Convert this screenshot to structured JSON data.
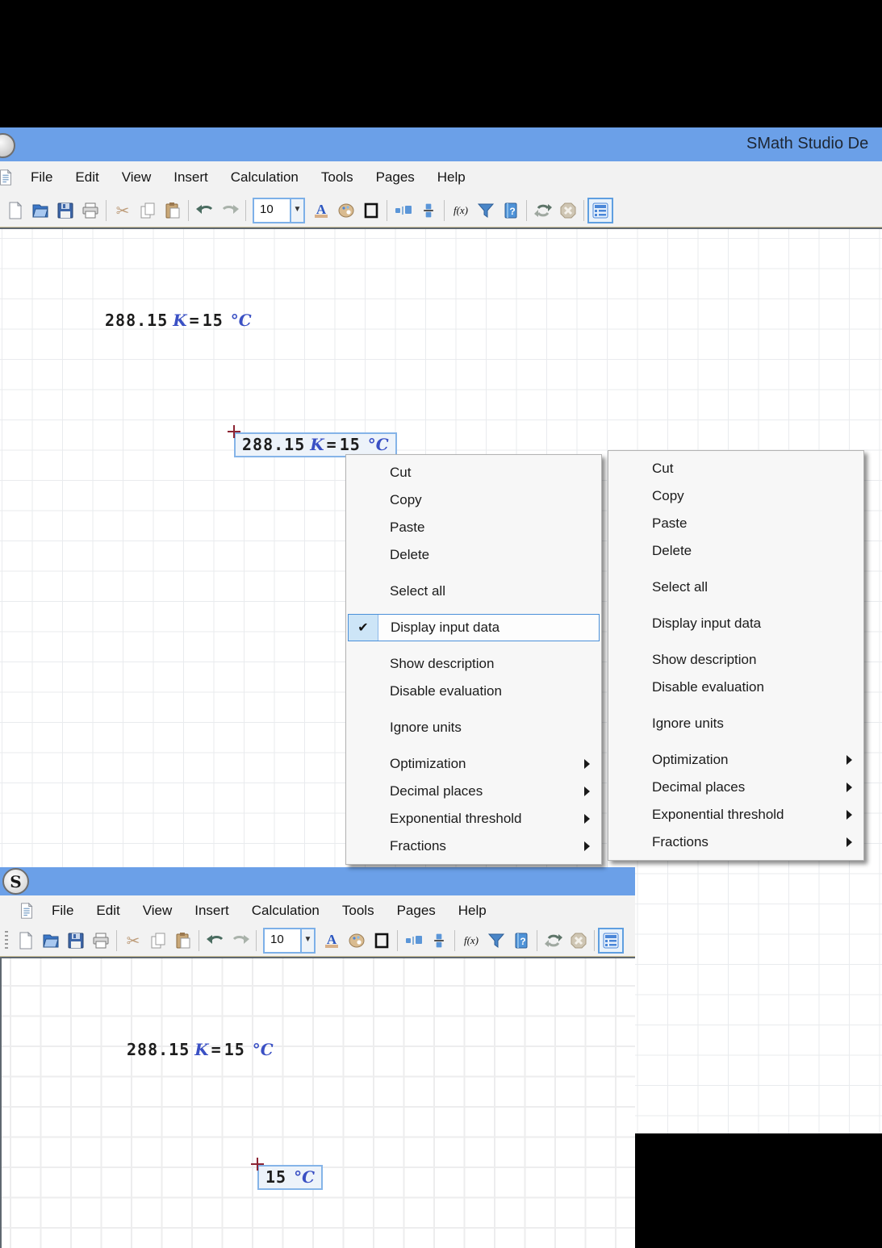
{
  "window_back": {
    "title": "SMath Studio De",
    "menu": [
      "File",
      "Edit",
      "View",
      "Insert",
      "Calculation",
      "Tools",
      "Pages",
      "Help"
    ],
    "toolbar": {
      "font_size": "10",
      "items": [
        "new",
        "open",
        "save",
        "print",
        "|",
        "cut",
        "copy",
        "paste",
        "|",
        "undo",
        "redo",
        "|",
        "fontsize",
        "fontcolor",
        "palette",
        "border",
        "|",
        "units",
        "fraction",
        "|",
        "fx",
        "filter",
        "helpbook",
        "|",
        "refresh",
        "stop",
        "|",
        "options"
      ]
    },
    "expression": {
      "lhs": "288.15",
      "lhs_unit": "K",
      "eq": "=",
      "rhs": "15",
      "rhs_unit": "°C"
    },
    "selected_expression": {
      "lhs": "288.15",
      "lhs_unit": "K",
      "eq": "=",
      "rhs": "15",
      "rhs_unit": "°C"
    }
  },
  "window_front": {
    "logo": "S",
    "menu": [
      "File",
      "Edit",
      "View",
      "Insert",
      "Calculation",
      "Tools",
      "Pages",
      "Help"
    ],
    "toolbar": {
      "grip": true,
      "font_size": "10",
      "items": [
        "new",
        "open",
        "save",
        "print",
        "|",
        "cut",
        "copy",
        "paste",
        "|",
        "undo",
        "redo",
        "|",
        "fontsize",
        "fontcolor",
        "palette",
        "border",
        "|",
        "units",
        "fraction",
        "|",
        "fx",
        "filter",
        "helpbook",
        "|",
        "refresh",
        "stop",
        "|",
        "options"
      ]
    },
    "expression": {
      "lhs": "288.15",
      "lhs_unit": "K",
      "eq": "=",
      "rhs": "15",
      "rhs_unit": "°C"
    },
    "selected_expression": {
      "rhs": "15",
      "rhs_unit": "°C"
    }
  },
  "menus": {
    "left": {
      "items": [
        {
          "label": "Cut"
        },
        {
          "label": "Copy"
        },
        {
          "label": "Paste"
        },
        {
          "label": "Delete"
        },
        {
          "label": "Select all",
          "gap": true
        },
        {
          "label": "Display input data",
          "gap": true,
          "checked": true,
          "highlighted": true
        },
        {
          "label": "Show description",
          "gap": true
        },
        {
          "label": "Disable evaluation"
        },
        {
          "label": "Ignore units",
          "gap": true
        },
        {
          "label": "Optimization",
          "gap": true,
          "submenu": true
        },
        {
          "label": "Decimal places",
          "submenu": true
        },
        {
          "label": "Exponential threshold",
          "submenu": true
        },
        {
          "label": "Fractions",
          "submenu": true
        }
      ]
    },
    "right": {
      "items": [
        {
          "label": "Cut"
        },
        {
          "label": "Copy"
        },
        {
          "label": "Paste"
        },
        {
          "label": "Delete"
        },
        {
          "label": "Select all",
          "gap": true
        },
        {
          "label": "Display input data",
          "gap": true
        },
        {
          "label": "Show description",
          "gap": true
        },
        {
          "label": "Disable evaluation"
        },
        {
          "label": "Ignore units",
          "gap": true
        },
        {
          "label": "Optimization",
          "gap": true,
          "submenu": true
        },
        {
          "label": "Decimal places",
          "submenu": true
        },
        {
          "label": "Exponential threshold",
          "submenu": true
        },
        {
          "label": "Fractions",
          "submenu": true
        }
      ]
    }
  },
  "colors": {
    "titlebar_blue": "#6ba0e8",
    "toolbar_bg": "#f2f2f2",
    "grid_line": "#e9ebee",
    "unit_text_blue": "#3a50c4",
    "selection_border": "#85b4e8",
    "menu_highlight_border": "#4a90d9",
    "menu_check_bg": "#cde5f7",
    "crosshair_red": "#8c2433",
    "surround_black": "#000000"
  }
}
